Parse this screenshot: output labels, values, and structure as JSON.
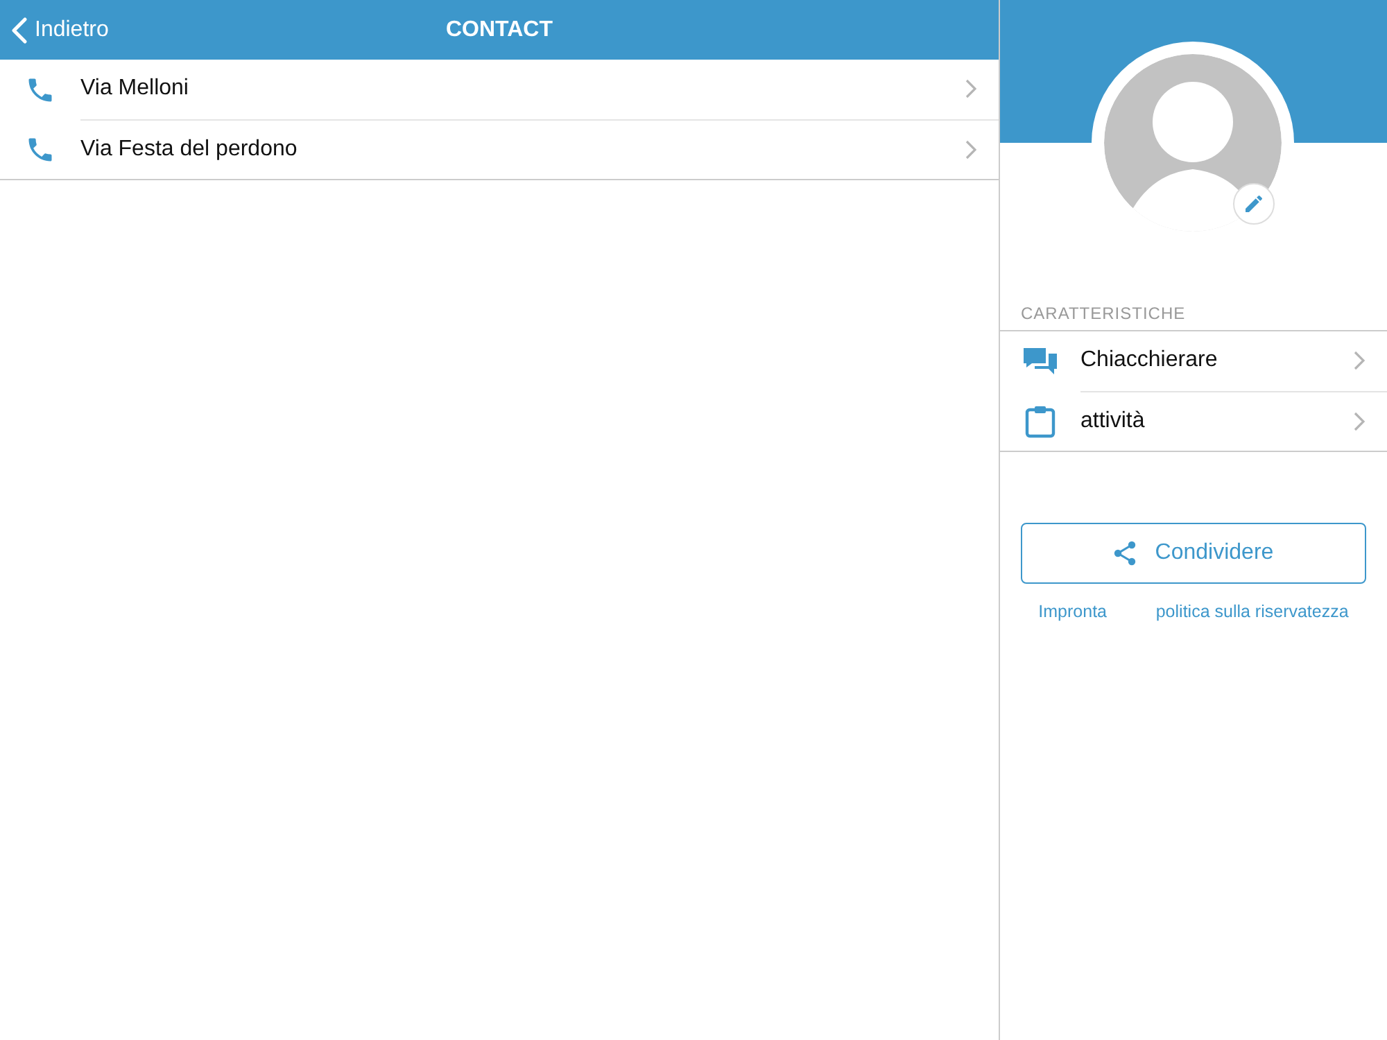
{
  "nav_bar": {
    "back_label": "Indietro",
    "title": "CONTACT"
  },
  "contacts": [
    {
      "label": "Via Melloni"
    },
    {
      "label": "Via Festa del perdono"
    }
  ],
  "profile": {
    "section_title": "CARATTERISTICHE",
    "features": [
      {
        "kind": "chat",
        "label": "Chiacchierare"
      },
      {
        "kind": "clipboard",
        "label": "attività"
      }
    ],
    "share_button": "Condividere",
    "links": [
      "Impronta",
      "politica sulla riservatezza"
    ]
  }
}
